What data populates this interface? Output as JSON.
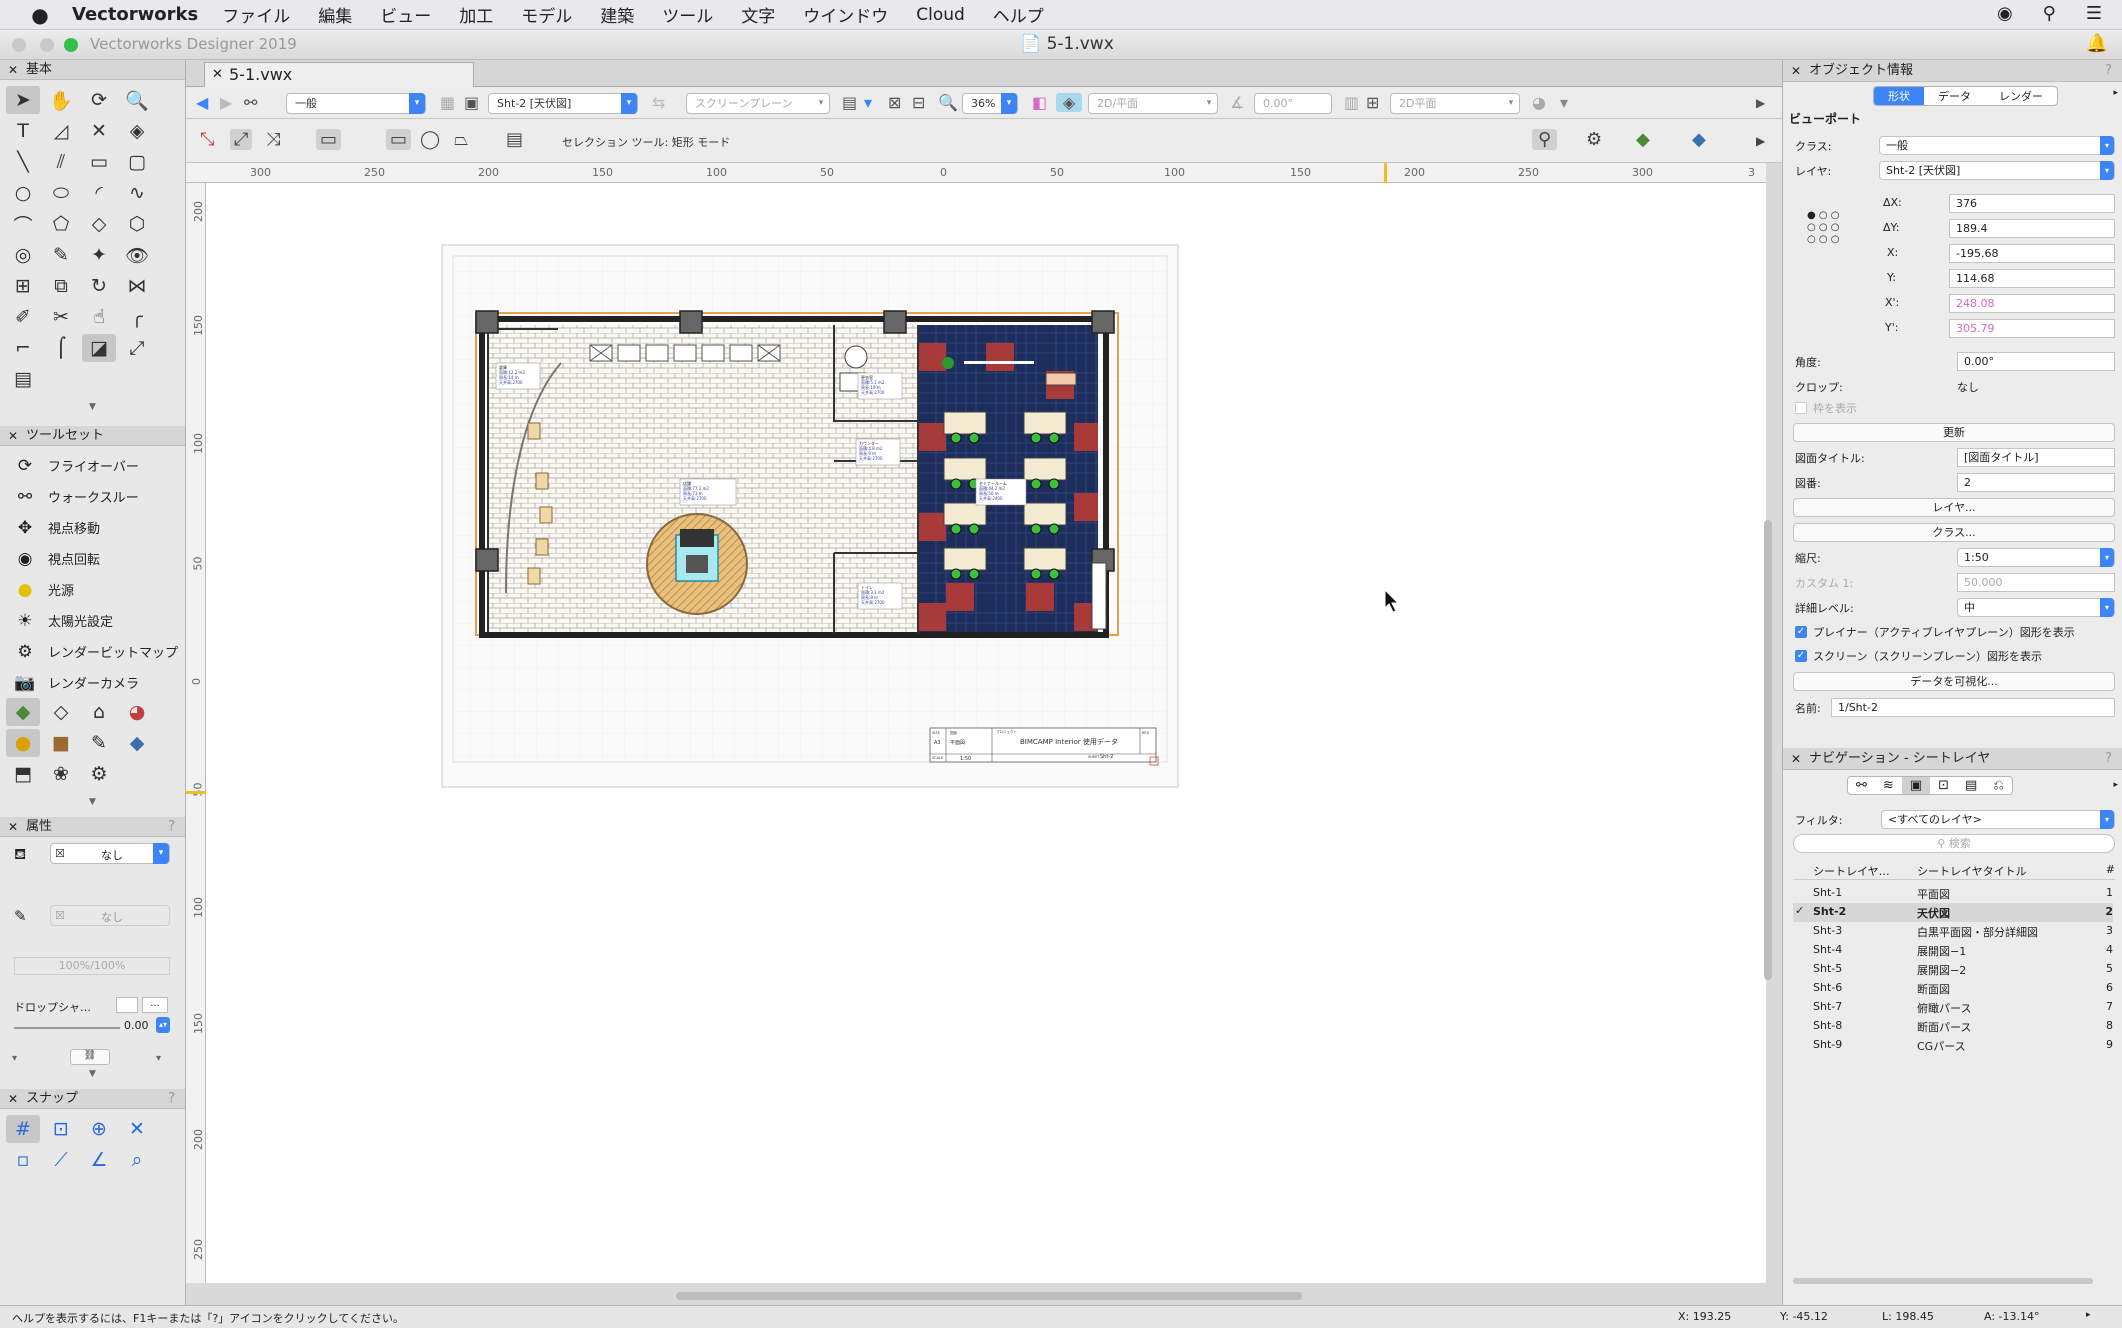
{
  "menubar": {
    "apple": "",
    "app": "Vectorworks",
    "items": [
      "ファイル",
      "編集",
      "ビュー",
      "加工",
      "モデル",
      "建築",
      "ツール",
      "文字",
      "ウインドウ",
      "Cloud",
      "ヘルプ"
    ]
  },
  "window": {
    "app_title": "Vectorworks Designer 2019",
    "doc_title": "5-1.vwx",
    "tab_label": "5-1.vwx"
  },
  "left": {
    "basic_title": "基本",
    "toolset_title": "ツールセット",
    "toolset_items": [
      "フライオーバー",
      "ウォークスルー",
      "視点移動",
      "視点回転",
      "光源",
      "太陽光設定",
      "レンダービットマップ",
      "レンダーカメラ"
    ],
    "attr_title": "属性",
    "attr_fill": "なし",
    "attr_pen": "なし",
    "opacity": "100%/100%",
    "dropshadow": "ドロップシャ…",
    "lineweight": "0.00",
    "snap_title": "スナップ"
  },
  "viewbar": {
    "class": "一般",
    "layer": "Sht-2 [天伏図]",
    "plane": "スクリーンプレーン",
    "zoom": "36%",
    "view": "2D/平面",
    "angle": "0.00°",
    "render": "2D平面"
  },
  "modebar": {
    "label": "セレクション ツール: 矩形 モード"
  },
  "rulers": {
    "h": [
      "300",
      "250",
      "200",
      "150",
      "100",
      "50",
      "0",
      "50",
      "100",
      "150",
      "200",
      "250",
      "300",
      "3"
    ],
    "v": [
      "200",
      "150",
      "100",
      "50",
      "0",
      "50",
      "100",
      "150",
      "200",
      "250"
    ]
  },
  "drawing": {
    "rooms": [
      {
        "name": "倉庫",
        "l1": "面積:12.2 m2",
        "l2": "周長:14 m",
        "l3": "天井高:2700"
      },
      {
        "name": "更衣室",
        "l1": "面積:5.1 m2",
        "l2": "周長:10 m",
        "l3": "天井高:2700"
      },
      {
        "name": "カウンター",
        "l1": "面積:4.8 m2",
        "l2": "周長:9 m",
        "l3": "天井高:2700"
      },
      {
        "name": "店舗",
        "l1": "面積:77.2 m2",
        "l2": "周長:73 m",
        "l3": "天井高:2700"
      },
      {
        "name": "セミナールーム",
        "l1": "面積:44.2 m2",
        "l2": "周長:50 m",
        "l3": "天井高:2400"
      },
      {
        "name": "トイレ",
        "l1": "面積:3.1 m2",
        "l2": "周長:8 m",
        "l3": "天井高:2700"
      }
    ],
    "titleblock": {
      "size_label": "SIZE",
      "size": "A3",
      "name_label": "図面",
      "name": "平面図",
      "project_label": "プロジェクト",
      "project": "BIMCAMP Interior 使用データ",
      "rev": "REV",
      "scale_label": "SCALE",
      "scale": "1:50",
      "sheet_label": "SHEET",
      "sheet": "Sht-2"
    }
  },
  "status": {
    "help": "ヘルプを表示するには、F1キーまたは「?」アイコンをクリックしてください。",
    "x": "X: 193.25",
    "y": "Y: -45.12",
    "l": "L: 198.45",
    "a": "A: -13.14°"
  },
  "objinfo": {
    "title": "オブジェクト情報",
    "tabs": [
      "形状",
      "データ",
      "レンダー"
    ],
    "section": "ビューポート",
    "class_label": "クラス:",
    "class": "一般",
    "layer_label": "レイヤ:",
    "layer": "Sht-2 [天伏図]",
    "dx_label": "ΔX:",
    "dx": "376",
    "dy_label": "ΔY:",
    "dy": "189.4",
    "x_label": "X:",
    "x": "-195.68",
    "y_label": "Y:",
    "y": "114.68",
    "x2_label": "X':",
    "x2": "248.08",
    "y2_label": "Y':",
    "y2": "305.79",
    "angle_label": "角度:",
    "angle": "0.00°",
    "crop_label": "クロップ:",
    "crop": "なし",
    "showframe": "枠を表示",
    "update_btn": "更新",
    "dwgtitle_label": "図面タイトル:",
    "dwgtitle": "[図面タイトル]",
    "dwgno_label": "図番:",
    "dwgno": "2",
    "layer_btn": "レイヤ...",
    "class_btn": "クラス...",
    "scale_label": "縮尺:",
    "scale": "1:50",
    "custom_label": "カスタム 1:",
    "custom": "50.000",
    "detail_label": "詳細レベル:",
    "detail": "中",
    "chk1": "プレイナー（アクティブレイヤプレーン）図形を表示",
    "chk2": "スクリーン（スクリーンプレーン）図形を表示",
    "visualize_btn": "データを可視化...",
    "name_label": "名前:",
    "name": "1/Sht-2"
  },
  "nav": {
    "title": "ナビゲーション - シートレイヤ",
    "filter_label": "フィルタ:",
    "filter": "<すべてのレイヤ>",
    "search": "検索",
    "col1": "シートレイヤ…",
    "col2": "シートレイヤタイトル",
    "col3": "#",
    "rows": [
      {
        "id": "Sht-1",
        "title": "平面図",
        "no": "1",
        "check": ""
      },
      {
        "id": "Sht-2",
        "title": "天伏図",
        "no": "2",
        "check": "✓"
      },
      {
        "id": "Sht-3",
        "title": "白黒平面図・部分詳細図",
        "no": "3",
        "check": ""
      },
      {
        "id": "Sht-4",
        "title": "展開図−1",
        "no": "4",
        "check": ""
      },
      {
        "id": "Sht-5",
        "title": "展開図−2",
        "no": "5",
        "check": ""
      },
      {
        "id": "Sht-6",
        "title": "断面図",
        "no": "6",
        "check": ""
      },
      {
        "id": "Sht-7",
        "title": "俯瞰パース",
        "no": "7",
        "check": ""
      },
      {
        "id": "Sht-8",
        "title": "断面パース",
        "no": "8",
        "check": ""
      },
      {
        "id": "Sht-9",
        "title": "CGパース",
        "no": "9",
        "check": ""
      }
    ]
  }
}
